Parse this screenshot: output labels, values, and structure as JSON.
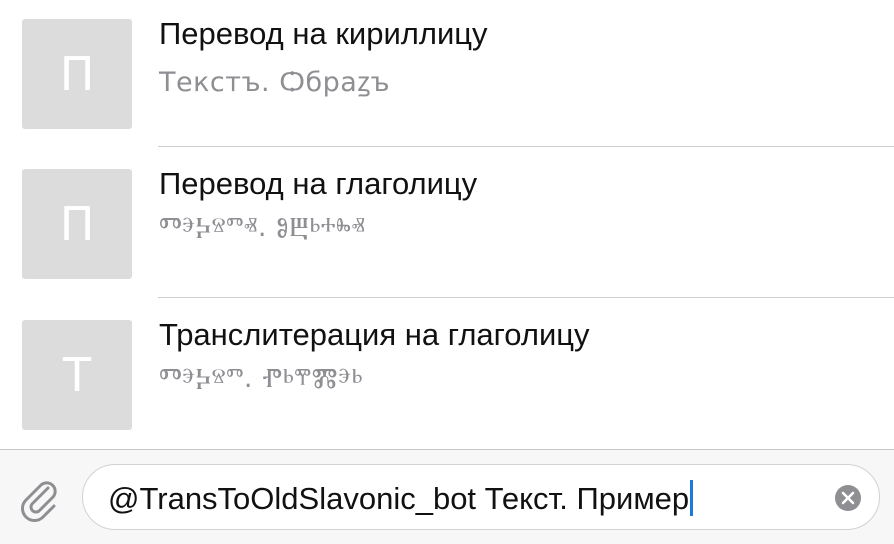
{
  "results": [
    {
      "thumb_letter": "П",
      "title": "Перевод на кириллицу",
      "preview": "Текстъ. Ѻбраꙁъ"
    },
    {
      "thumb_letter": "П",
      "title": "Перевод на глаголицу",
      "preview": "ⰕⰵⰍⱄⱅⱏ. ⰑⰁⱃⰰⰸⱏ"
    },
    {
      "thumb_letter": "Т",
      "title": "Транслитерация на глаголицу",
      "preview": "ⰕⰵⰍⱄⱅ. ⰒⱃⰹⰏⰵⱃ"
    }
  ],
  "input": {
    "value": "@TransToOldSlavonic_bot Текст. Пример"
  },
  "icons": {
    "attach": "paperclip-icon",
    "clear": "clear-circle-icon"
  },
  "colors": {
    "caret": "#1f7ae0",
    "thumb_bg": "#dcdcdc",
    "preview_text": "#8e8e93"
  }
}
